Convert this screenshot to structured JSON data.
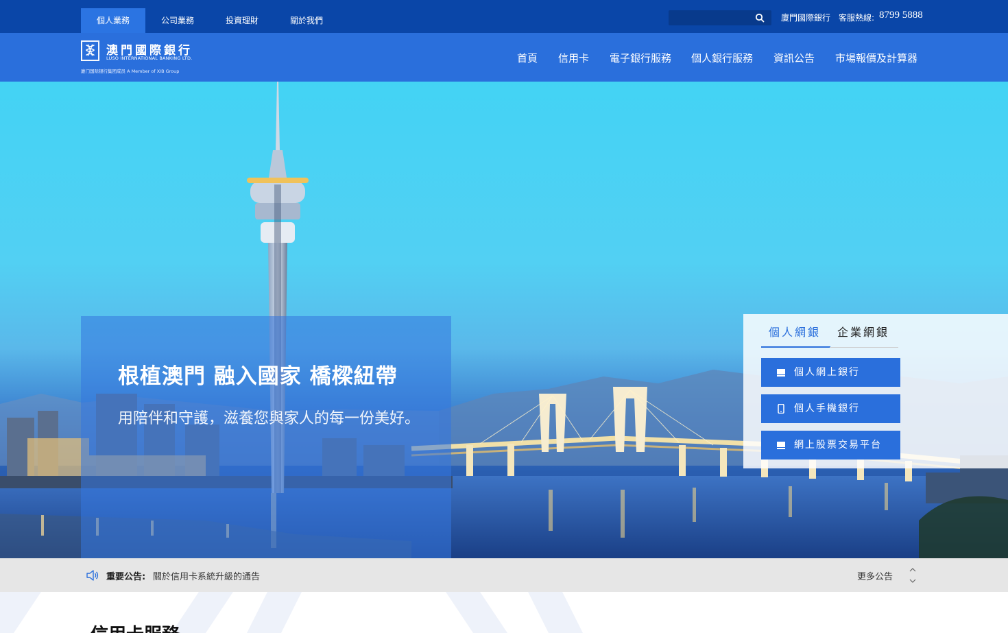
{
  "topbar": {
    "segments": [
      "個人業務",
      "公司業務",
      "投資理財",
      "關於我們"
    ],
    "active_segment": "個人業務",
    "search": {
      "placeholder": "",
      "icon": "search-icon"
    },
    "bank_name": "廈門國際銀行",
    "hotline_label": "客服熱線:",
    "hotline_number": "8799 5888"
  },
  "logo": {
    "cn": "澳門國際銀行",
    "en": "LUSO INTERNATIONAL BANKING LTD.",
    "sub": "廈门国际银行集团成员 A Member of XIB Group"
  },
  "nav": [
    "首頁",
    "信用卡",
    "電子銀行服務",
    "個人銀行服務",
    "資訊公告",
    "市場報價及計算器"
  ],
  "hero": {
    "title": "根植澳門 融入國家 橋樑紐帶",
    "subtitle": "用陪伴和守護，滋養您與家人的每一份美好。"
  },
  "ebank": {
    "tabs": [
      "個人網銀",
      "企業網銀"
    ],
    "active_tab": "個人網銀",
    "buttons": [
      {
        "label": "個人網上銀行",
        "icon": "desktop-icon"
      },
      {
        "label": "個人手機銀行",
        "icon": "mobile-icon"
      },
      {
        "label": "網上股票交易平台",
        "icon": "desktop-icon"
      }
    ]
  },
  "notice": {
    "label": "重要公告:",
    "text": "關於信用卡系統升級的通告",
    "more": "更多公告"
  },
  "section": {
    "title": "信用卡服務"
  },
  "colors": {
    "topbar": "#0a46a8",
    "header": "#2a6fdc",
    "accent": "#2a6fdc",
    "notice_bg": "#e6e6e6"
  }
}
